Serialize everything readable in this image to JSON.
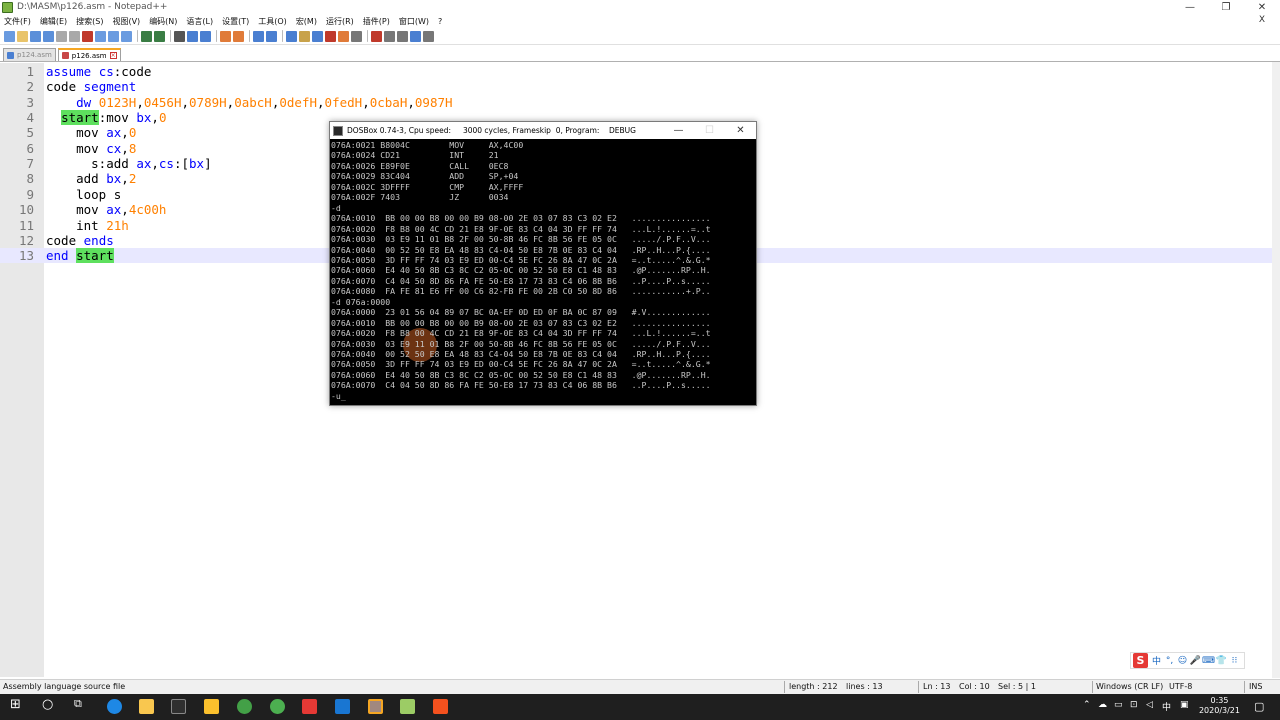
{
  "window": {
    "title": "D:\\MASM\\p126.asm - Notepad++",
    "controls": [
      "—",
      "❐",
      "✕"
    ]
  },
  "menu": [
    "文件(F)",
    "编辑(E)",
    "搜索(S)",
    "视图(V)",
    "编码(N)",
    "语言(L)",
    "设置(T)",
    "工具(O)",
    "宏(M)",
    "运行(R)",
    "插件(P)",
    "窗口(W)",
    "?"
  ],
  "menu_close": "X",
  "tabs": [
    {
      "label": "p124.asm"
    },
    {
      "label": "p126.asm"
    }
  ],
  "editor": {
    "lines": [
      {
        "num": "1",
        "segs": [
          {
            "t": "assume ",
            "c": "k"
          },
          {
            "t": "cs",
            "c": "k"
          },
          {
            "t": ":code",
            "c": "b"
          }
        ]
      },
      {
        "num": "2",
        "segs": [
          {
            "t": "code ",
            "c": "b"
          },
          {
            "t": "segment",
            "c": "k"
          }
        ]
      },
      {
        "num": "3",
        "segs": [
          {
            "t": "    ",
            "c": "b"
          },
          {
            "t": "dw ",
            "c": "k"
          },
          {
            "t": "0123H",
            "c": "n"
          },
          {
            "t": ",",
            "c": "b"
          },
          {
            "t": "0456H",
            "c": "n"
          },
          {
            "t": ",",
            "c": "b"
          },
          {
            "t": "0789H",
            "c": "n"
          },
          {
            "t": ",",
            "c": "b"
          },
          {
            "t": "0abcH",
            "c": "n"
          },
          {
            "t": ",",
            "c": "b"
          },
          {
            "t": "0defH",
            "c": "n"
          },
          {
            "t": ",",
            "c": "b"
          },
          {
            "t": "0fedH",
            "c": "n"
          },
          {
            "t": ",",
            "c": "b"
          },
          {
            "t": "0cbaH",
            "c": "n"
          },
          {
            "t": ",",
            "c": "b"
          },
          {
            "t": "0987H",
            "c": "n"
          }
        ]
      },
      {
        "num": "4",
        "segs": [
          {
            "t": "  ",
            "c": "b"
          },
          {
            "t": "start",
            "c": "hl"
          },
          {
            "t": ":mov ",
            "c": "b"
          },
          {
            "t": "bx",
            "c": "k"
          },
          {
            "t": ",",
            "c": "b"
          },
          {
            "t": "0",
            "c": "n"
          }
        ]
      },
      {
        "num": "5",
        "segs": [
          {
            "t": "    mov ",
            "c": "b"
          },
          {
            "t": "ax",
            "c": "k"
          },
          {
            "t": ",",
            "c": "b"
          },
          {
            "t": "0",
            "c": "n"
          }
        ]
      },
      {
        "num": "6",
        "segs": [
          {
            "t": "    mov ",
            "c": "b"
          },
          {
            "t": "cx",
            "c": "k"
          },
          {
            "t": ",",
            "c": "b"
          },
          {
            "t": "8",
            "c": "n"
          }
        ]
      },
      {
        "num": "7",
        "segs": [
          {
            "t": "      s:add ",
            "c": "b"
          },
          {
            "t": "ax",
            "c": "k"
          },
          {
            "t": ",",
            "c": "b"
          },
          {
            "t": "cs",
            "c": "k"
          },
          {
            "t": ":[",
            "c": "b"
          },
          {
            "t": "bx",
            "c": "k"
          },
          {
            "t": "]",
            "c": "b"
          }
        ]
      },
      {
        "num": "8",
        "segs": [
          {
            "t": "    add ",
            "c": "b"
          },
          {
            "t": "bx",
            "c": "k"
          },
          {
            "t": ",",
            "c": "b"
          },
          {
            "t": "2",
            "c": "n"
          }
        ]
      },
      {
        "num": "9",
        "segs": [
          {
            "t": "    loop s",
            "c": "b"
          }
        ]
      },
      {
        "num": "10",
        "segs": [
          {
            "t": "    mov ",
            "c": "b"
          },
          {
            "t": "ax",
            "c": "k"
          },
          {
            "t": ",",
            "c": "b"
          },
          {
            "t": "4c00h",
            "c": "n"
          }
        ]
      },
      {
        "num": "11",
        "segs": [
          {
            "t": "    int ",
            "c": "b"
          },
          {
            "t": "21h",
            "c": "n"
          }
        ]
      },
      {
        "num": "12",
        "segs": [
          {
            "t": "code ",
            "c": "b"
          },
          {
            "t": "ends",
            "c": "k"
          }
        ]
      },
      {
        "num": "13",
        "segs": [
          {
            "t": "end ",
            "c": "k"
          },
          {
            "t": "start",
            "c": "hl"
          }
        ]
      }
    ]
  },
  "dosbox": {
    "title": "DOSBox 0.74-3, Cpu speed:     3000 cycles, Frameskip  0, Program:    DEBUG",
    "lines": [
      "076A:0021 B8004C        MOV     AX,4C00",
      "076A:0024 CD21          INT     21",
      "076A:0026 E89F0E        CALL    0EC8",
      "076A:0029 83C404        ADD     SP,+04",
      "076A:002C 3DFFFF        CMP     AX,FFFF",
      "076A:002F 7403          JZ      0034",
      "-d",
      "076A:0010  BB 00 00 B8 00 00 B9 08-00 2E 03 07 83 C3 02 E2   ................",
      "076A:0020  F8 B8 00 4C CD 21 E8 9F-0E 83 C4 04 3D FF FF 74   ...L.!......=..t",
      "076A:0030  03 E9 11 01 B8 2F 00 50-8B 46 FC 8B 56 FE 05 0C   ...../.P.F..V...",
      "076A:0040  00 52 50 E8 EA 48 83 C4-04 50 E8 7B 0E 83 C4 04   .RP..H...P.{....",
      "076A:0050  3D FF FF 74 03 E9 ED 00-C4 5E FC 26 8A 47 0C 2A   =..t.....^.&.G.*",
      "076A:0060  E4 40 50 8B C3 8C C2 05-0C 00 52 50 E8 C1 48 83   .@P.......RP..H.",
      "076A:0070  C4 04 50 8D 86 FA FE 50-E8 17 73 83 C4 06 8B B6   ..P....P..s.....",
      "076A:0080  FA FE 81 E6 FF 00 C6 82-FB FE 00 2B C0 50 8D 86   ...........+.P..",
      "-d 076a:0000",
      "076A:0000  23 01 56 04 89 07 BC 0A-EF 0D ED 0F BA 0C 87 09   #.V.............",
      "076A:0010  BB 00 00 B8 00 00 B9 08-00 2E 03 07 83 C3 02 E2   ................",
      "076A:0020  F8 B8 00 4C CD 21 E8 9F-0E 83 C4 04 3D FF FF 74   ...L.!......=..t",
      "076A:0030  03 E9 11 01 B8 2F 00 50-8B 46 FC 8B 56 FE 05 0C   ...../.P.F..V...",
      "076A:0040  00 52 50 E8 EA 48 83 C4-04 50 E8 7B 0E 83 C4 04   .RP..H...P.{....",
      "076A:0050  3D FF FF 74 03 E9 ED 00-C4 5E FC 26 8A 47 0C 2A   =..t.....^.&.G.*",
      "076A:0060  E4 40 50 8B C3 8C C2 05-0C 00 52 50 E8 C1 48 83   .@P.......RP..H.",
      "076A:0070  C4 04 50 8D 86 FA FE 50-E8 17 73 83 C4 06 8B B6   ..P....P..s.....",
      "-u_"
    ]
  },
  "ime": {
    "logo": "S",
    "glyphs": [
      "中",
      "°,",
      "☺",
      "🎤",
      "⌨",
      "👕",
      "⁝⁝"
    ]
  },
  "status": {
    "filetype": "Assembly language source file",
    "length": "length : 212",
    "lines": "lines : 13",
    "ln": "Ln : 13",
    "col": "Col : 10",
    "sel": "Sel : 5 | 1",
    "eol": "Windows (CR LF)",
    "encoding": "UTF-8",
    "mode": "INS"
  },
  "taskbar": {
    "tray_lang": "中",
    "time": "0:35",
    "date": "2020/3/21"
  },
  "colors": {
    "keyword": "#0000ff",
    "number": "#ff8000",
    "highlight": "#5ee05e",
    "current_line": "#e8e8ff"
  }
}
